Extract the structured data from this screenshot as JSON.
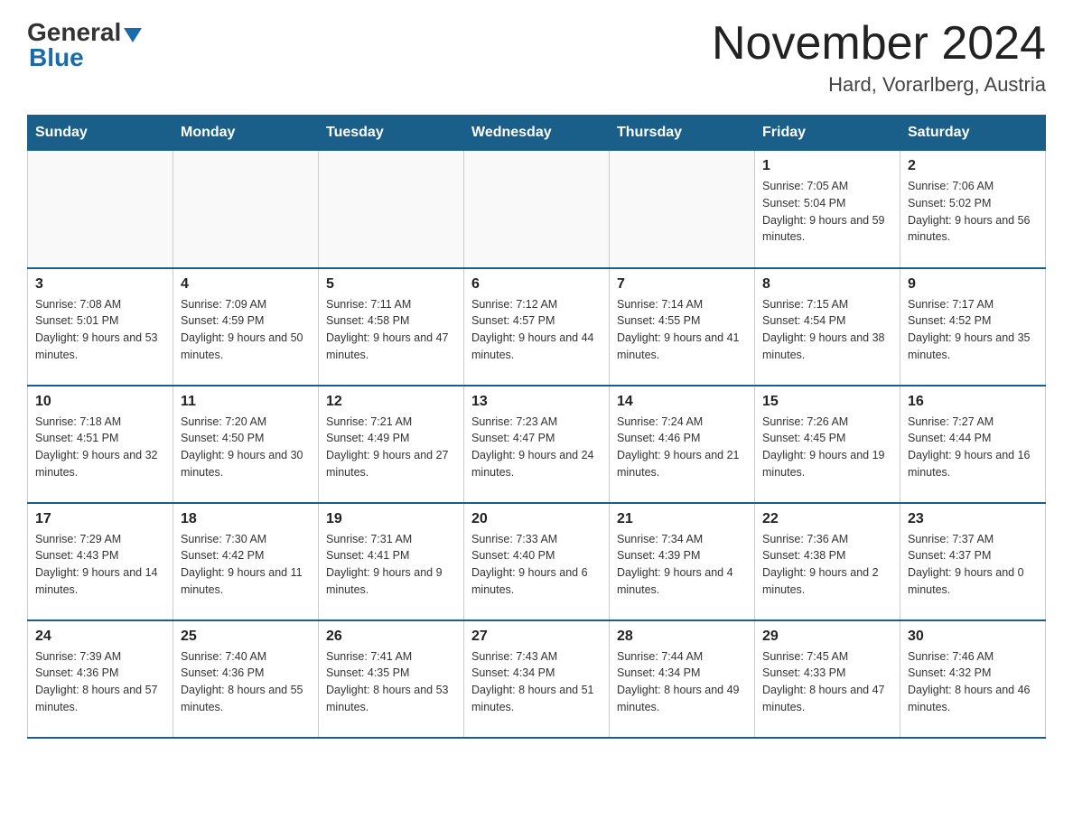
{
  "header": {
    "logo_general": "General",
    "logo_blue": "Blue",
    "month_title": "November 2024",
    "subtitle": "Hard, Vorarlberg, Austria"
  },
  "days_of_week": [
    "Sunday",
    "Monday",
    "Tuesday",
    "Wednesday",
    "Thursday",
    "Friday",
    "Saturday"
  ],
  "weeks": [
    [
      {
        "day": "",
        "info": ""
      },
      {
        "day": "",
        "info": ""
      },
      {
        "day": "",
        "info": ""
      },
      {
        "day": "",
        "info": ""
      },
      {
        "day": "",
        "info": ""
      },
      {
        "day": "1",
        "info": "Sunrise: 7:05 AM\nSunset: 5:04 PM\nDaylight: 9 hours and 59 minutes."
      },
      {
        "day": "2",
        "info": "Sunrise: 7:06 AM\nSunset: 5:02 PM\nDaylight: 9 hours and 56 minutes."
      }
    ],
    [
      {
        "day": "3",
        "info": "Sunrise: 7:08 AM\nSunset: 5:01 PM\nDaylight: 9 hours and 53 minutes."
      },
      {
        "day": "4",
        "info": "Sunrise: 7:09 AM\nSunset: 4:59 PM\nDaylight: 9 hours and 50 minutes."
      },
      {
        "day": "5",
        "info": "Sunrise: 7:11 AM\nSunset: 4:58 PM\nDaylight: 9 hours and 47 minutes."
      },
      {
        "day": "6",
        "info": "Sunrise: 7:12 AM\nSunset: 4:57 PM\nDaylight: 9 hours and 44 minutes."
      },
      {
        "day": "7",
        "info": "Sunrise: 7:14 AM\nSunset: 4:55 PM\nDaylight: 9 hours and 41 minutes."
      },
      {
        "day": "8",
        "info": "Sunrise: 7:15 AM\nSunset: 4:54 PM\nDaylight: 9 hours and 38 minutes."
      },
      {
        "day": "9",
        "info": "Sunrise: 7:17 AM\nSunset: 4:52 PM\nDaylight: 9 hours and 35 minutes."
      }
    ],
    [
      {
        "day": "10",
        "info": "Sunrise: 7:18 AM\nSunset: 4:51 PM\nDaylight: 9 hours and 32 minutes."
      },
      {
        "day": "11",
        "info": "Sunrise: 7:20 AM\nSunset: 4:50 PM\nDaylight: 9 hours and 30 minutes."
      },
      {
        "day": "12",
        "info": "Sunrise: 7:21 AM\nSunset: 4:49 PM\nDaylight: 9 hours and 27 minutes."
      },
      {
        "day": "13",
        "info": "Sunrise: 7:23 AM\nSunset: 4:47 PM\nDaylight: 9 hours and 24 minutes."
      },
      {
        "day": "14",
        "info": "Sunrise: 7:24 AM\nSunset: 4:46 PM\nDaylight: 9 hours and 21 minutes."
      },
      {
        "day": "15",
        "info": "Sunrise: 7:26 AM\nSunset: 4:45 PM\nDaylight: 9 hours and 19 minutes."
      },
      {
        "day": "16",
        "info": "Sunrise: 7:27 AM\nSunset: 4:44 PM\nDaylight: 9 hours and 16 minutes."
      }
    ],
    [
      {
        "day": "17",
        "info": "Sunrise: 7:29 AM\nSunset: 4:43 PM\nDaylight: 9 hours and 14 minutes."
      },
      {
        "day": "18",
        "info": "Sunrise: 7:30 AM\nSunset: 4:42 PM\nDaylight: 9 hours and 11 minutes."
      },
      {
        "day": "19",
        "info": "Sunrise: 7:31 AM\nSunset: 4:41 PM\nDaylight: 9 hours and 9 minutes."
      },
      {
        "day": "20",
        "info": "Sunrise: 7:33 AM\nSunset: 4:40 PM\nDaylight: 9 hours and 6 minutes."
      },
      {
        "day": "21",
        "info": "Sunrise: 7:34 AM\nSunset: 4:39 PM\nDaylight: 9 hours and 4 minutes."
      },
      {
        "day": "22",
        "info": "Sunrise: 7:36 AM\nSunset: 4:38 PM\nDaylight: 9 hours and 2 minutes."
      },
      {
        "day": "23",
        "info": "Sunrise: 7:37 AM\nSunset: 4:37 PM\nDaylight: 9 hours and 0 minutes."
      }
    ],
    [
      {
        "day": "24",
        "info": "Sunrise: 7:39 AM\nSunset: 4:36 PM\nDaylight: 8 hours and 57 minutes."
      },
      {
        "day": "25",
        "info": "Sunrise: 7:40 AM\nSunset: 4:36 PM\nDaylight: 8 hours and 55 minutes."
      },
      {
        "day": "26",
        "info": "Sunrise: 7:41 AM\nSunset: 4:35 PM\nDaylight: 8 hours and 53 minutes."
      },
      {
        "day": "27",
        "info": "Sunrise: 7:43 AM\nSunset: 4:34 PM\nDaylight: 8 hours and 51 minutes."
      },
      {
        "day": "28",
        "info": "Sunrise: 7:44 AM\nSunset: 4:34 PM\nDaylight: 8 hours and 49 minutes."
      },
      {
        "day": "29",
        "info": "Sunrise: 7:45 AM\nSunset: 4:33 PM\nDaylight: 8 hours and 47 minutes."
      },
      {
        "day": "30",
        "info": "Sunrise: 7:46 AM\nSunset: 4:32 PM\nDaylight: 8 hours and 46 minutes."
      }
    ]
  ]
}
